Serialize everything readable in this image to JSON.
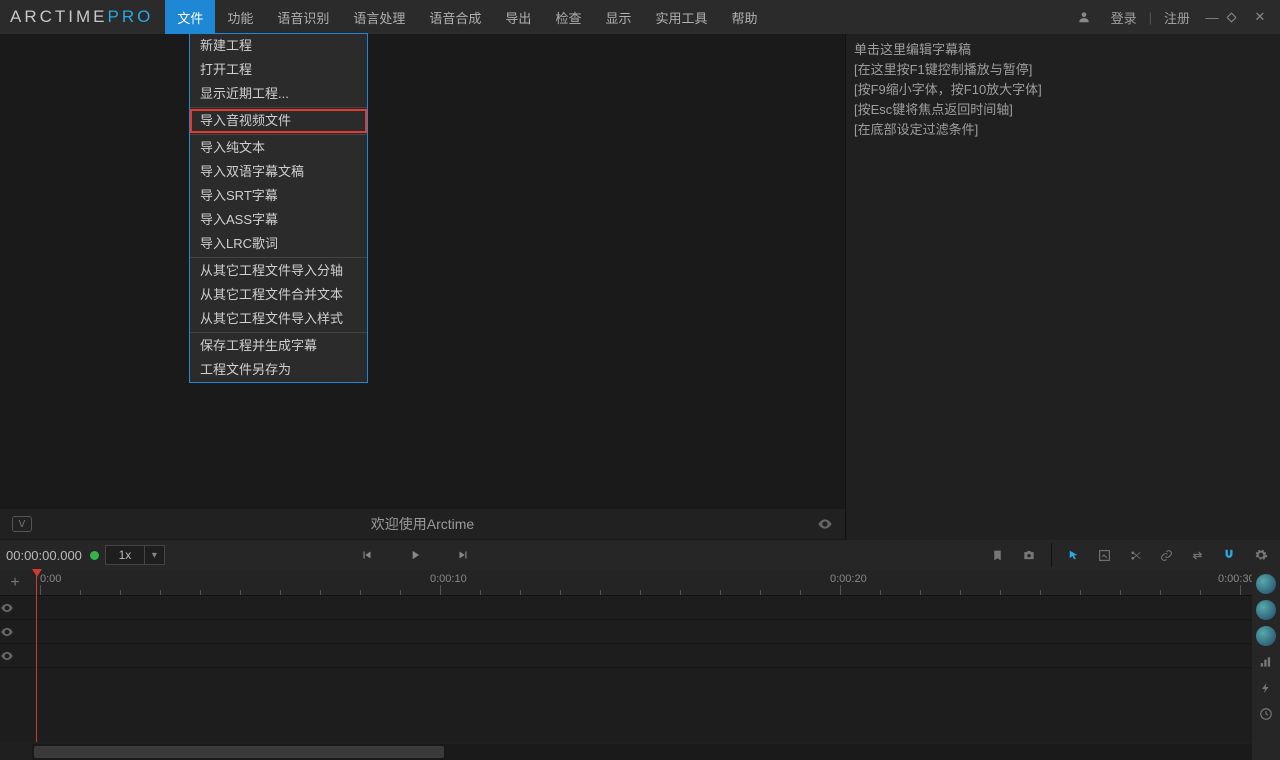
{
  "app": {
    "logo_main": "ARCTIME",
    "logo_suffix": "PRO"
  },
  "menu": {
    "items": [
      "文件",
      "功能",
      "语音识别",
      "语言处理",
      "语音合成",
      "导出",
      "检查",
      "显示",
      "实用工具",
      "帮助"
    ],
    "active_index": 0
  },
  "menubar_right": {
    "login": "登录",
    "register": "注册"
  },
  "dropdown": {
    "groups": [
      [
        "新建工程",
        "打开工程",
        "显示近期工程..."
      ],
      [
        "导入音视频文件"
      ],
      [
        "导入纯文本",
        "导入双语字幕文稿",
        "导入SRT字幕",
        "导入ASS字幕",
        "导入LRC歌词"
      ],
      [
        "从其它工程文件导入分轴",
        "从其它工程文件合并文本",
        "从其它工程文件导入样式"
      ],
      [
        "保存工程并生成字幕",
        "工程文件另存为"
      ]
    ],
    "highlighted": "导入音视频文件"
  },
  "video_footer": {
    "badge": "V",
    "welcome": "欢迎使用Arctime"
  },
  "draft": {
    "lines": [
      "单击这里编辑字幕稿",
      "[在这里按F1键控制播放与暂停]",
      "[按F9缩小字体，按F10放大字体]",
      "[按Esc键将焦点返回时间轴]",
      "[在底部设定过滤条件]"
    ]
  },
  "transport": {
    "timecode": "00:00:00.000",
    "speed": "1x"
  },
  "timeline": {
    "ticks": [
      {
        "label": "0:00",
        "pos": 40
      },
      {
        "label": "0:00:10",
        "pos": 430
      },
      {
        "label": "0:00:20",
        "pos": 830
      },
      {
        "label": "0:00:30",
        "pos": 1220
      }
    ]
  }
}
